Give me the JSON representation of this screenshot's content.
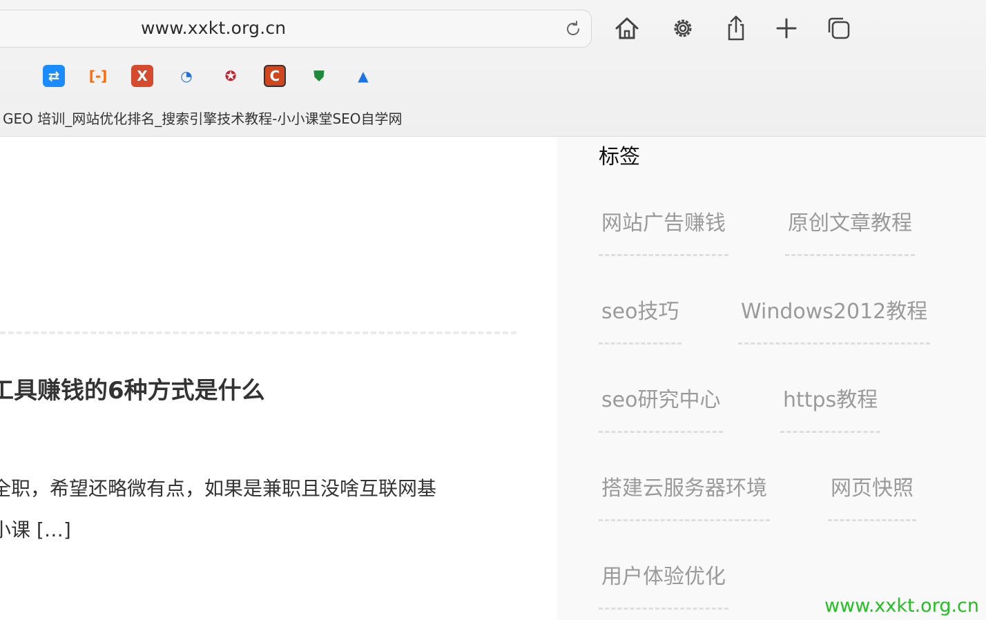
{
  "browser": {
    "url": "www.xxkt.org.cn",
    "page_title": "GEO 培训_网站优化排名_搜索引擎技术教程-小小课堂SEO自学网",
    "toolbar_icons": [
      "home-icon",
      "gear-icon",
      "share-icon",
      "plus-icon",
      "tabs-icon"
    ],
    "favorites": [
      {
        "name": "favorite-blue",
        "symbol": "⇄",
        "color": "#1a8cff"
      },
      {
        "name": "favorite-orange-bracket",
        "symbol": "[-]",
        "color": "#ff6a00"
      },
      {
        "name": "favorite-red-x",
        "symbol": "X",
        "color": "#d64a2e"
      },
      {
        "name": "favorite-blue-swirl",
        "symbol": "◔",
        "color": "#1f6fd6"
      },
      {
        "name": "favorite-emblem",
        "symbol": "✪",
        "color": "#c8202a"
      },
      {
        "name": "favorite-c",
        "symbol": "C",
        "color": "#d0461f"
      },
      {
        "name": "favorite-green-shield",
        "symbol": "⛊",
        "color": "#1e8a3a"
      },
      {
        "name": "favorite-blue-peak",
        "symbol": "▲",
        "color": "#1a73e8"
      }
    ]
  },
  "main": {
    "article_title": "工具赚钱的6种方式是什么",
    "excerpt_line1": "全职，希望还略微有点，如果是兼职且没啥互联网基",
    "excerpt_line2": "小课 […]"
  },
  "sidebar": {
    "title": "标签",
    "tags": [
      "网站广告赚钱",
      "原创文章教程",
      "seo技巧",
      "Windows2012教程",
      "seo研究中心",
      "https教程",
      "搭建云服务器环境",
      "网页快照",
      "用户体验优化"
    ]
  },
  "watermark": "www.xxkt.org.cn"
}
